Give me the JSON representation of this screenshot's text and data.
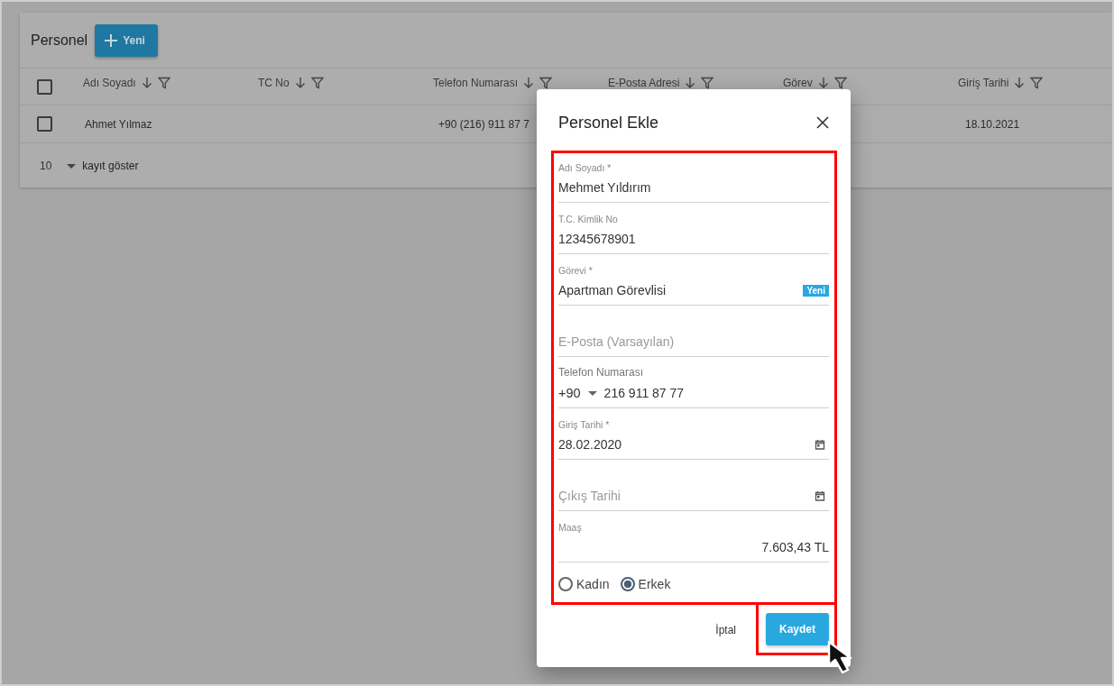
{
  "page": {
    "title": "Personel",
    "new_button": "Yeni"
  },
  "table": {
    "header_checkbox": {
      "checked": false
    },
    "columns": [
      {
        "label": "Adı Soyadı"
      },
      {
        "label": "TC No"
      },
      {
        "label": "Telefon Numarası"
      },
      {
        "label": "E-Posta Adresi"
      },
      {
        "label": "Görev"
      },
      {
        "label": "Giriş Tarihi"
      }
    ],
    "rows": [
      {
        "checked": false,
        "cells": [
          "Ahmet Yılmaz",
          "",
          "+90 (216) 911 87 7",
          "",
          "",
          "18.10.2021"
        ]
      }
    ],
    "page_size": "10",
    "page_size_label": "kayıt göster"
  },
  "dialog": {
    "title": "Personel Ekle",
    "fields": [
      {
        "kind": "text",
        "label": "Adı Soyadı *",
        "value": "Mehmet Yıldırım"
      },
      {
        "kind": "text",
        "label": "T.C. Kimlik No",
        "value": "12345678901"
      },
      {
        "kind": "text",
        "label": "Görevi *",
        "value": "Apartman Görevlisi",
        "badge": "Yeni"
      },
      {
        "kind": "text",
        "placeholder": "E-Posta (Varsayılan)"
      },
      {
        "kind": "phone",
        "label": "Telefon Numarası",
        "country_code": "+90",
        "value": "216 911 87 77"
      },
      {
        "kind": "date",
        "label": "Giriş Tarihi *",
        "value": "28.02.2020"
      },
      {
        "kind": "date",
        "placeholder": "Çıkış Tarihi"
      },
      {
        "kind": "money",
        "label": "Maaş",
        "value": "7.603,43 TL"
      }
    ],
    "gender": [
      {
        "label": "Kadın",
        "selected": false
      },
      {
        "label": "Erkek",
        "selected": true
      }
    ],
    "cancel_button": "İptal",
    "save_button": "Kaydet"
  }
}
